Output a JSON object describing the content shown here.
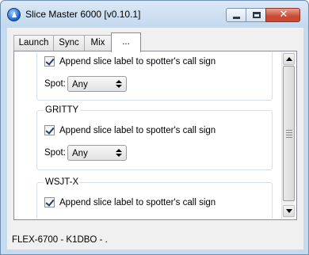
{
  "window": {
    "title": "Slice Master 6000 [v0.10.1]",
    "close_glyph": "✕"
  },
  "tabs": [
    {
      "label": "Launch",
      "active": false
    },
    {
      "label": "Sync",
      "active": false
    },
    {
      "label": "Mix",
      "active": false
    },
    {
      "label": "...",
      "active": true
    }
  ],
  "groups": [
    {
      "name": "",
      "checkbox_label": "Append slice label to spotter's call sign",
      "checked": true,
      "spot_label": "Spot:",
      "spot_value": "Any"
    },
    {
      "name": "GRITTY",
      "checkbox_label": "Append slice label to spotter's call sign",
      "checked": true,
      "spot_label": "Spot:",
      "spot_value": "Any"
    },
    {
      "name": "WSJT-X",
      "checkbox_label": "Append slice label to spotter's call sign",
      "checked": true
    }
  ],
  "status": {
    "text": "FLEX-6700 - K1DBO - ."
  }
}
